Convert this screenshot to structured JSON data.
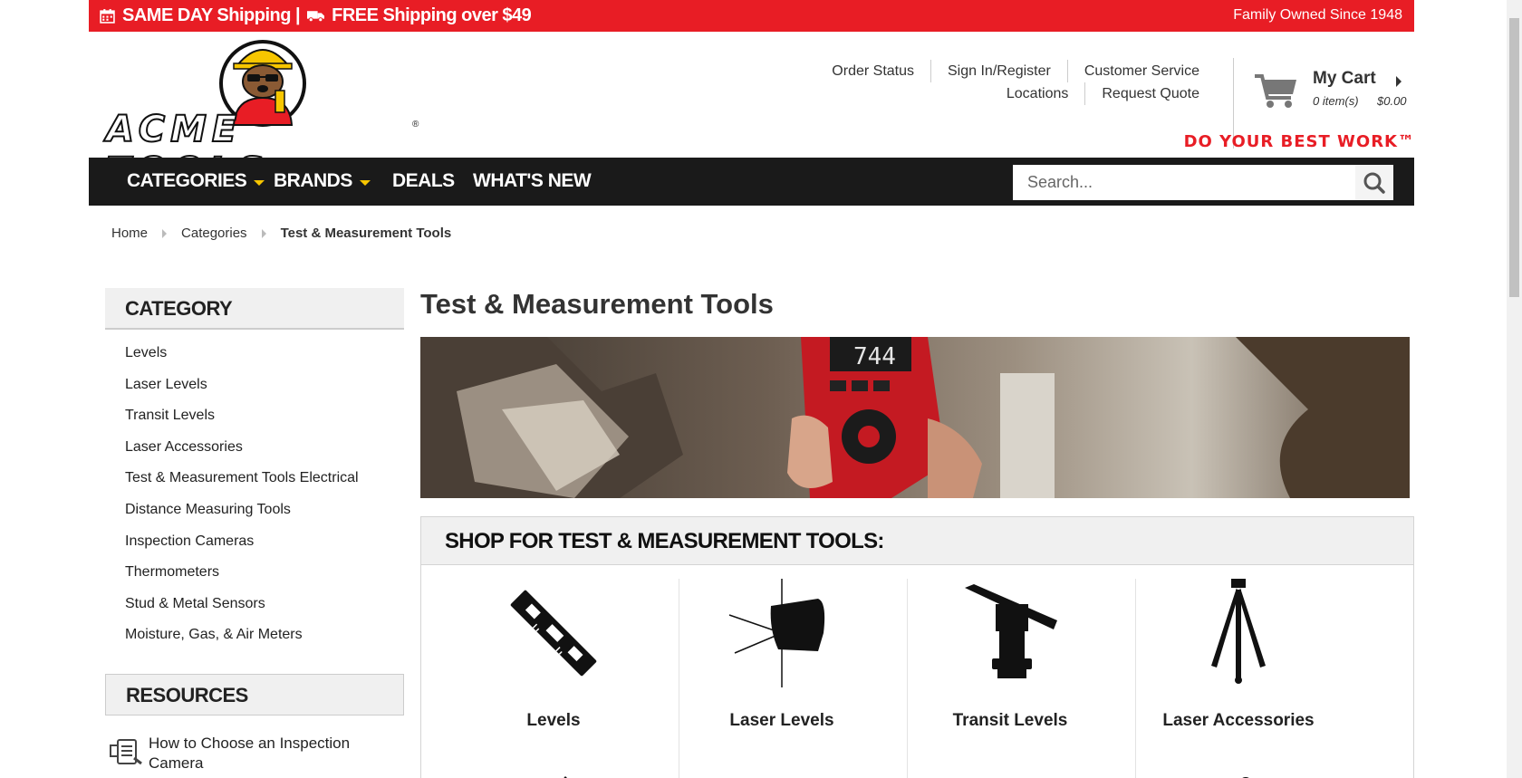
{
  "promo": {
    "left_text": "SAME DAY Shipping |  FREE Shipping over $49",
    "shipping_same_day": "SAME DAY Shipping |",
    "shipping_free": "FREE Shipping over $49",
    "right_text": "Family Owned Since 1948"
  },
  "logo": {
    "wordmark": "ACME TOOLS",
    "reg": "®"
  },
  "toplinks": {
    "order_status": "Order Status",
    "sign_in": "Sign In/Register",
    "customer_service": "Customer Service",
    "locations": "Locations",
    "request_quote": "Request Quote"
  },
  "cart": {
    "title": "My Cart",
    "count": "0 item(s)",
    "total": "$0.00"
  },
  "tagline": "DO YOUR BEST WORK™",
  "nav": {
    "categories": "CATEGORIES",
    "brands": "BRANDS",
    "deals": "DEALS",
    "whats_new": "WHAT'S NEW"
  },
  "search": {
    "placeholder": "Search..."
  },
  "breadcrumb": [
    "Home",
    "Categories",
    "Test & Measurement Tools"
  ],
  "sidebar": {
    "heading": "CATEGORY",
    "items": [
      "Levels",
      "Laser Levels",
      "Transit Levels",
      "Laser Accessories",
      "Test & Measurement Tools Electrical",
      "Distance Measuring Tools",
      "Inspection Cameras",
      "Thermometers",
      "Stud & Metal Sensors",
      "Moisture, Gas, & Air Meters"
    ],
    "resources_heading": "RESOURCES",
    "resource_link": "How to Choose an Inspection Camera"
  },
  "main": {
    "title": "Test & Measurement Tools",
    "hero_display": "744",
    "shop_heading": "SHOP FOR TEST & MEASUREMENT TOOLS:",
    "tiles": [
      "Levels",
      "Laser Levels",
      "Transit Levels",
      "Laser Accessories"
    ]
  },
  "colors": {
    "brand_red": "#e81d25",
    "nav_dark": "#1a1a1a",
    "nav_accent": "#f7c600"
  }
}
